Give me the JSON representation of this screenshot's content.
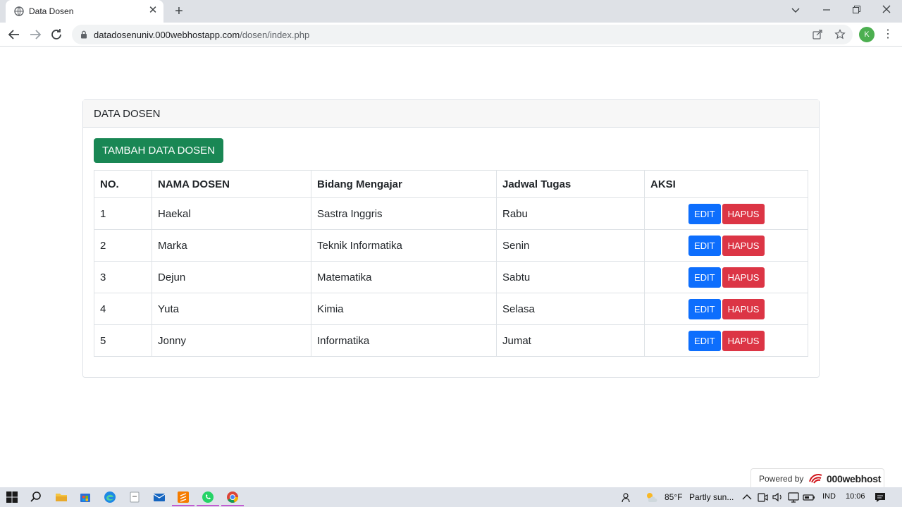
{
  "browser": {
    "tab_title": "Data Dosen",
    "url_host": "datadosenuniv.000webhostapp.com",
    "url_path": "/dosen/index.php",
    "profile_initial": "K"
  },
  "card": {
    "header": "DATA DOSEN",
    "add_button": "TAMBAH DATA DOSEN"
  },
  "table": {
    "headers": {
      "no": "NO.",
      "nama": "NAMA DOSEN",
      "bidang": "Bidang Mengajar",
      "jadwal": "Jadwal Tugas",
      "aksi": "AKSI"
    },
    "rows": [
      {
        "no": "1",
        "nama": "Haekal",
        "bidang": "Sastra Inggris",
        "jadwal": "Rabu"
      },
      {
        "no": "2",
        "nama": "Marka",
        "bidang": "Teknik Informatika",
        "jadwal": "Senin"
      },
      {
        "no": "3",
        "nama": "Dejun",
        "bidang": "Matematika",
        "jadwal": "Sabtu"
      },
      {
        "no": "4",
        "nama": "Yuta",
        "bidang": "Kimia",
        "jadwal": "Selasa"
      },
      {
        "no": "5",
        "nama": "Jonny",
        "bidang": "Informatika",
        "jadwal": "Jumat"
      }
    ],
    "edit_label": "EDIT",
    "delete_label": "HAPUS"
  },
  "footer": {
    "powered_label": "Powered by",
    "powered_brand": "000webhost"
  },
  "taskbar": {
    "weather": "85°F",
    "weather_desc": "Partly sun...",
    "language": "IND",
    "time": "10:06"
  },
  "colors": {
    "add_button": "#198754",
    "edit_button": "#0d6efd",
    "delete_button": "#dc3545"
  }
}
